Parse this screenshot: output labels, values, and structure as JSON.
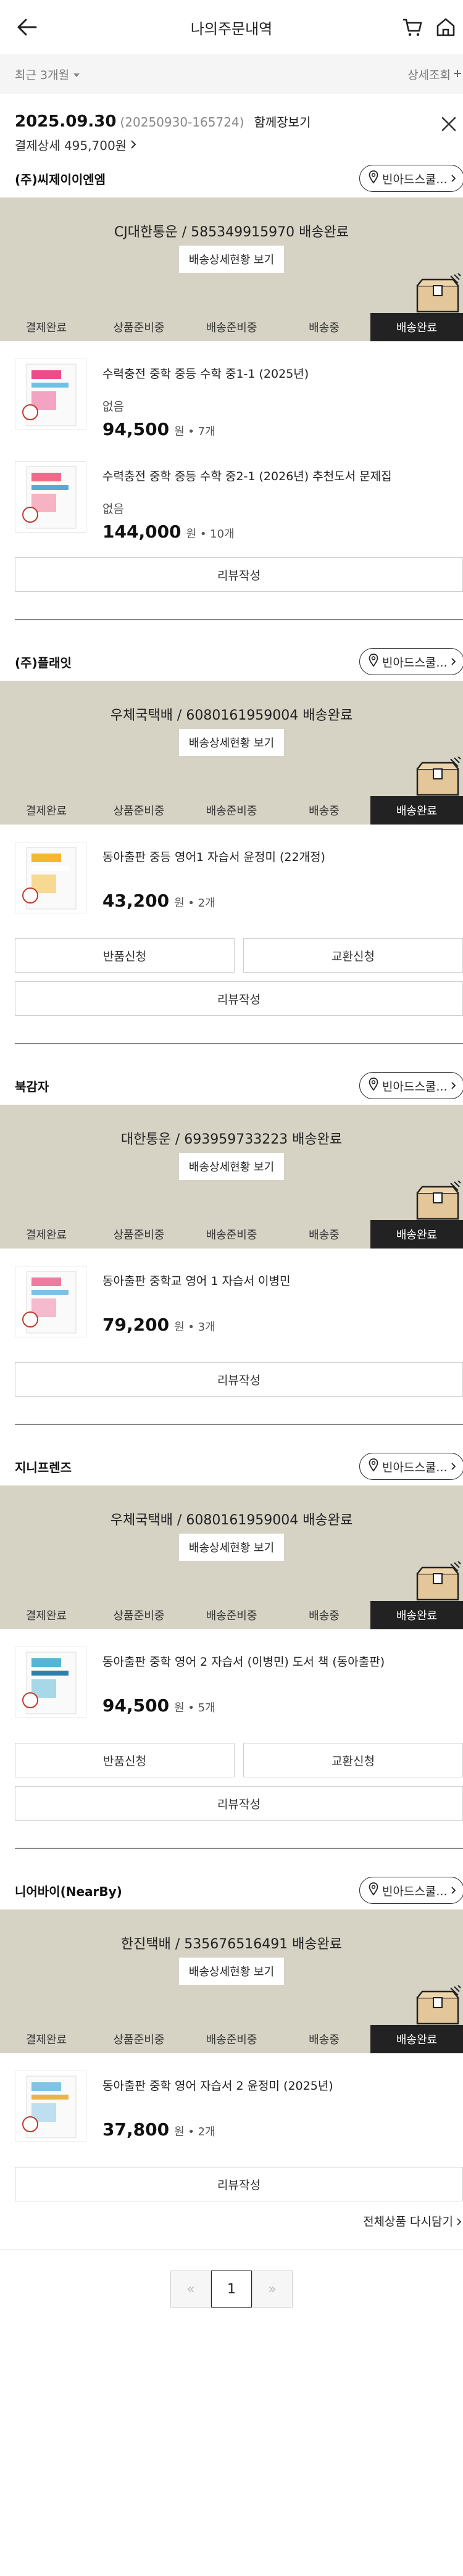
{
  "header": {
    "title": "나의주문내역"
  },
  "filter": {
    "period": "최근 3개월",
    "detail_search": "상세조회"
  },
  "order": {
    "date": "2025.09.30",
    "order_no": "(20250930-165724)",
    "bundle_label": "함께장보기",
    "pay_detail": "결제상세 495,700원"
  },
  "steps": [
    "결제완료",
    "상품준비중",
    "배송준비중",
    "배송중",
    "배송완료"
  ],
  "store_button_label": "빈아드스쿨...",
  "track_button_label": "배송상세현황 보기",
  "sellers": [
    {
      "name": "(주)씨제이이엔엠",
      "courier": "CJ대한통운 / 585349915970 배송완료",
      "items": [
        {
          "name": "수력충전 중학 중등 수학 중1-1 (2025년)",
          "option": "없음",
          "price": "94,500",
          "qty": "원 • 7개"
        },
        {
          "name": "수력충전 중학 중등 수학 중2-1 (2026년) 추천도서 문제집",
          "option": "없음",
          "price": "144,000",
          "qty": "원 • 10개"
        }
      ],
      "buttons": [
        "리뷰작성"
      ]
    },
    {
      "name": "(주)플래잇",
      "courier": "우체국택배 / 6080161959004 배송완료",
      "items": [
        {
          "name": "동아출판 중등 영어1 자습서 윤정미 (22개정)",
          "option": "",
          "price": "43,200",
          "qty": "원 • 2개"
        }
      ],
      "buttons": [
        "반품신청",
        "교환신청",
        "리뷰작성"
      ]
    },
    {
      "name": "북감자",
      "courier": "대한통운 / 693959733223 배송완료",
      "items": [
        {
          "name": "동아출판 중학교 영어 1 자습서 이병민",
          "option": "",
          "price": "79,200",
          "qty": "원 • 3개"
        }
      ],
      "buttons": [
        "리뷰작성"
      ]
    },
    {
      "name": "지니프렌즈",
      "courier": "우체국택배 / 6080161959004 배송완료",
      "items": [
        {
          "name": "동아출판 중학 영어 2 자습서 (이병민) 도서 책 (동아출판)",
          "option": "",
          "price": "94,500",
          "qty": "원 • 5개"
        }
      ],
      "buttons": [
        "반품신청",
        "교환신청",
        "리뷰작성"
      ]
    },
    {
      "name": "니어바이(NearBy)",
      "courier": "한진택배 / 535676516491 배송완료",
      "items": [
        {
          "name": "동아출판 중학 영어 자습서 2 윤정미 (2025년)",
          "option": "",
          "price": "37,800",
          "qty": "원 • 2개"
        }
      ],
      "buttons": [
        "리뷰작성"
      ]
    }
  ],
  "reorder_all": "전체상품 다시담기",
  "pagination": {
    "prev": "«",
    "current": "1",
    "next": "»"
  },
  "colors": {
    "panel": "#d6d2c4",
    "active_step": "#222222",
    "box": "#e3c79a"
  }
}
